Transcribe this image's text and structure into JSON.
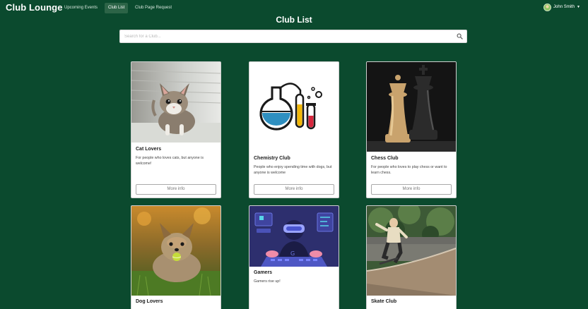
{
  "navbar": {
    "brand": "Club Lounge",
    "links": [
      "Upcoming Events",
      "Club List",
      "Club Page Request"
    ],
    "active_link": "Club List",
    "user_name": "John Smith"
  },
  "page": {
    "title": "Club List",
    "search_placeholder": "Search for a Club..."
  },
  "clubs": [
    {
      "name": "Cat Lovers",
      "description": "For people who loves cats, but anyone is welcome!",
      "button": "More info",
      "image": "kitten-photo"
    },
    {
      "name": "Chemistry Club",
      "description": "People who enjoy spending time with dogs, but anyone is welcome",
      "button": "More info",
      "image": "chemistry-flasks-illustration"
    },
    {
      "name": "Chess Club",
      "description": "For people who loves to play chess or want to learn chess.",
      "button": "More info",
      "image": "chess-pieces-photo"
    },
    {
      "name": "Dog Lovers",
      "description": "",
      "button": "",
      "image": "yorkie-dog-photo"
    },
    {
      "name": "Gamers",
      "description": "Gamers rise up!",
      "button": "",
      "image": "gamer-vr-illustration"
    },
    {
      "name": "Skate Club",
      "description": "",
      "button": "",
      "image": "skateboarder-photo"
    }
  ],
  "colors": {
    "background": "#0b4a2e",
    "active_nav": "#2c6447",
    "card": "#ffffff"
  }
}
